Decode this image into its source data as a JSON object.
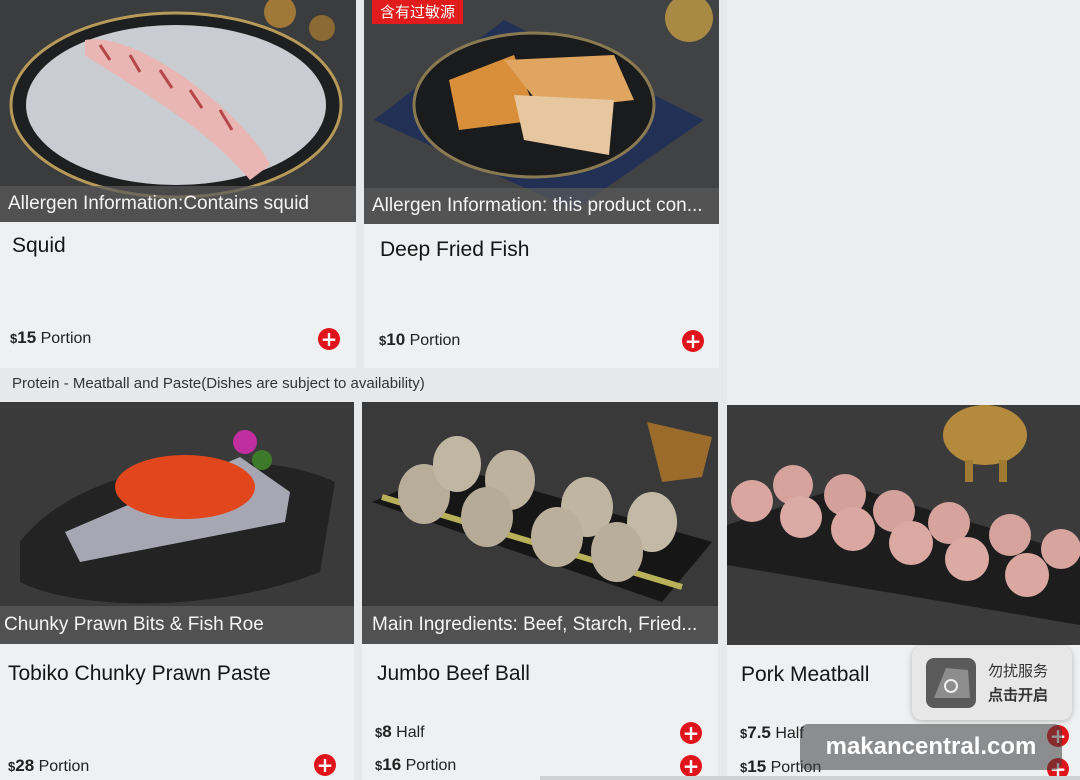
{
  "top_row": [
    {
      "name": "Squid",
      "caption": "Allergen Information:Contains squid",
      "prices": [
        {
          "amount": "15",
          "unit": "Portion"
        }
      ]
    },
    {
      "badge": "含有过敏源",
      "name": "Deep Fried Fish",
      "caption": "Allergen Information: this product con...",
      "prices": [
        {
          "amount": "10",
          "unit": "Portion"
        }
      ]
    }
  ],
  "section_label": "Protein - Meatball and Paste(Dishes are subject to availability)",
  "bottom_row": [
    {
      "name": "Tobiko Chunky Prawn Paste",
      "caption": "Chunky Prawn Bits & Fish Roe",
      "prices": [
        {
          "amount": "28",
          "unit": "Portion"
        }
      ]
    },
    {
      "name": "Jumbo Beef Ball",
      "caption": "Main Ingredients: Beef, Starch, Fried...",
      "prices": [
        {
          "amount": "8",
          "unit": "Half"
        },
        {
          "amount": "16",
          "unit": "Portion"
        }
      ]
    },
    {
      "name": "Pork Meatball",
      "prices": [
        {
          "amount": "7.5",
          "unit": "Half"
        },
        {
          "amount": "15",
          "unit": "Portion"
        }
      ]
    }
  ],
  "currency": "$",
  "add_symbol": "+",
  "dnd": {
    "line1": "勿扰服务",
    "line2": "点击开启"
  },
  "watermark": "makancentral.com",
  "colors": {
    "accent": "#e0151c",
    "card_bg": "#eef0f1"
  },
  "icons": {
    "add": "plus-circle-icon",
    "dnd": "do-not-disturb-icon"
  }
}
